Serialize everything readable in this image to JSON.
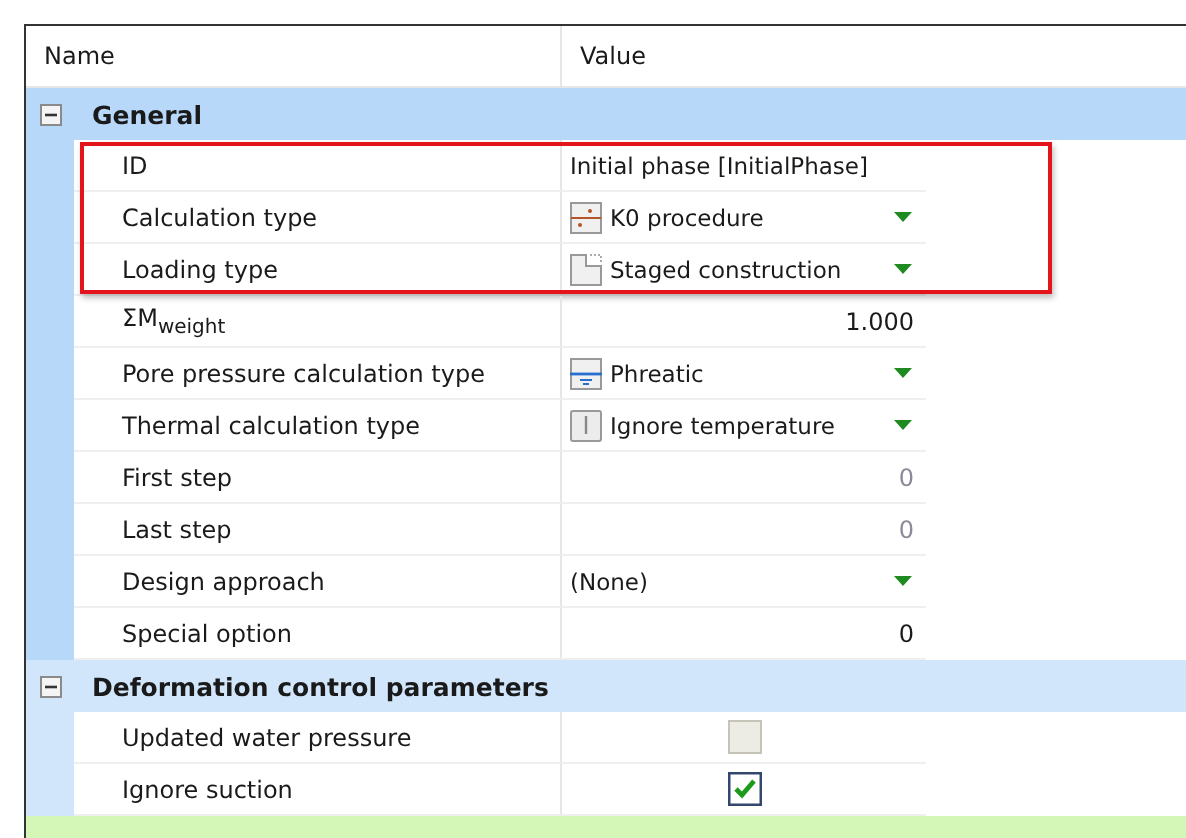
{
  "columns": [
    "Name",
    "Value"
  ],
  "groups": [
    {
      "title": "General",
      "expanded": true,
      "selected": true,
      "rows": [
        {
          "name": "ID",
          "highlighted": true,
          "value": {
            "kind": "text",
            "text": "Initial phase [InitialPhase]"
          }
        },
        {
          "name": "Calculation type",
          "highlighted": true,
          "value": {
            "kind": "dropdown",
            "text": "K0 procedure"
          }
        },
        {
          "name": "Loading type",
          "highlighted": true,
          "value": {
            "kind": "dropdown",
            "text": "Staged construction"
          }
        },
        {
          "name": "ΣM$_{weight}$",
          "highlighted": false,
          "value": {
            "kind": "number",
            "text": "1.000",
            "disabled": false
          }
        },
        {
          "name": "Pore pressure calculation type",
          "highlighted": false,
          "value": {
            "kind": "dropdown",
            "text": "Phreatic"
          }
        },
        {
          "name": "Thermal calculation type",
          "highlighted": false,
          "value": {
            "kind": "dropdown",
            "text": "Ignore temperature"
          }
        },
        {
          "name": "First step",
          "highlighted": false,
          "value": {
            "kind": "number",
            "text": "0",
            "disabled": true
          }
        },
        {
          "name": "Last step",
          "highlighted": false,
          "value": {
            "kind": "number",
            "text": "0",
            "disabled": true
          }
        },
        {
          "name": "Design approach",
          "highlighted": false,
          "value": {
            "kind": "dropdown",
            "text": "(None)"
          }
        },
        {
          "name": "Special option",
          "highlighted": false,
          "value": {
            "kind": "number",
            "text": "0",
            "disabled": false
          }
        }
      ]
    },
    {
      "title": "Deformation control parameters",
      "expanded": true,
      "selected": false,
      "rows": [
        {
          "name": "Updated water pressure",
          "highlighted": false,
          "value": {
            "kind": "checkbox",
            "checked": false,
            "disabled": true
          }
        },
        {
          "name": "Ignore suction",
          "highlighted": false,
          "value": {
            "kind": "checkbox",
            "checked": true,
            "disabled": false
          }
        }
      ]
    }
  ]
}
